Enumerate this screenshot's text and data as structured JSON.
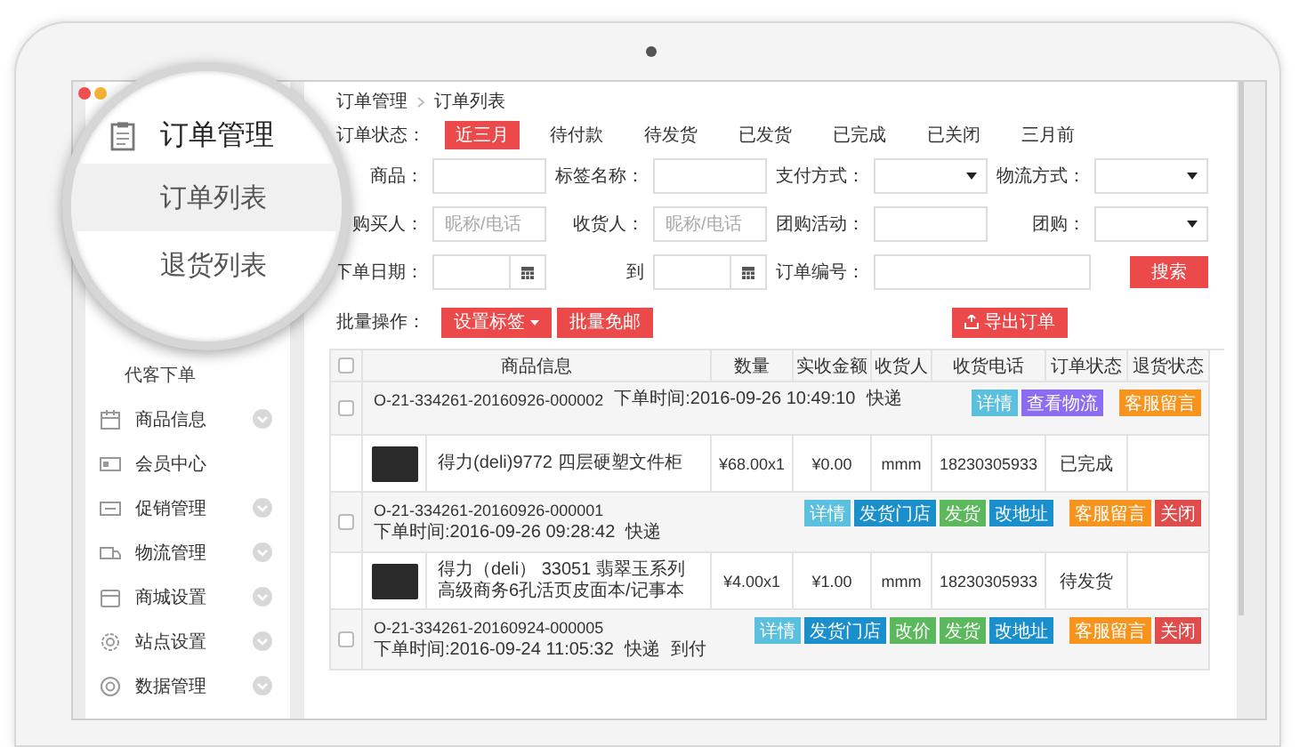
{
  "magnifier": {
    "title": "订单管理",
    "items": [
      {
        "label": "订单列表",
        "selected": true
      },
      {
        "label": "退货列表",
        "selected": false
      }
    ]
  },
  "sidebar": {
    "sub_items": [
      "代客下单"
    ],
    "sections": [
      {
        "label": "商品信息",
        "expandable": true
      },
      {
        "label": "会员中心",
        "expandable": false
      },
      {
        "label": "促销管理",
        "expandable": true
      },
      {
        "label": "物流管理",
        "expandable": true
      },
      {
        "label": "商城设置",
        "expandable": true
      },
      {
        "label": "站点设置",
        "expandable": true
      },
      {
        "label": "数据管理",
        "expandable": true
      }
    ]
  },
  "breadcrumb": [
    "订单管理",
    "订单列表"
  ],
  "status_filter": {
    "label": "订单状态：",
    "tabs": [
      {
        "label": "近三月",
        "selected": true
      },
      {
        "label": "待付款",
        "selected": false
      },
      {
        "label": "待发货",
        "selected": false
      },
      {
        "label": "已发货",
        "selected": false
      },
      {
        "label": "已完成",
        "selected": false
      },
      {
        "label": "已关闭",
        "selected": false
      },
      {
        "label": "三月前",
        "selected": false
      }
    ]
  },
  "filters": [
    [
      {
        "label": "商品：",
        "kind": "text"
      },
      {
        "label": "标签名称：",
        "kind": "text"
      },
      {
        "label": "支付方式：",
        "kind": "select"
      },
      {
        "label": "物流方式：",
        "kind": "select"
      }
    ],
    [
      {
        "label": "购买人：",
        "kind": "text",
        "placeholder": "昵称/电话"
      },
      {
        "label": "收货人：",
        "kind": "text",
        "placeholder": "昵称/电话"
      },
      {
        "label": "团购活动：",
        "kind": "text"
      },
      {
        "label": "团购：",
        "kind": "select"
      }
    ],
    [
      {
        "label": "下单日期：",
        "kind": "date"
      },
      {
        "label": "到",
        "kind": "date"
      },
      {
        "label": "订单编号：",
        "kind": "wide"
      }
    ]
  ],
  "search_button": "搜索",
  "batch": {
    "label": "批量操作：",
    "buttons": [
      {
        "label": "设置标签",
        "dropdown": true
      },
      {
        "label": "批量免邮",
        "dropdown": false
      }
    ],
    "export_button": "导出订单"
  },
  "table": {
    "columns": [
      "商品信息",
      "数量",
      "实收金额",
      "收货人",
      "收货电话",
      "订单状态",
      "退货状态"
    ],
    "header_checked": false,
    "orders": [
      {
        "checked": false,
        "order_no": "O-21-334261-20160926-000002",
        "time": "下单时间:2016-09-26 10:49:10",
        "tags": [
          "快递"
        ],
        "actions": [
          {
            "label": "详情",
            "kind": "info"
          },
          {
            "label": "查看物流",
            "kind": "purple"
          }
        ],
        "service_actions": [
          {
            "label": "客服留言",
            "kind": "warning"
          }
        ],
        "items": [
          {
            "name": "得力(deli)9772 四层硬塑文件柜",
            "quantity": "¥68.00x1",
            "paid": "¥0.00",
            "receiver": "mmm",
            "phone": "18230305933",
            "order_status": "已完成"
          }
        ]
      },
      {
        "checked": false,
        "order_no": "O-21-334261-20160926-000001",
        "time": "下单时间:2016-09-26 09:28:42",
        "tags": [
          "快递"
        ],
        "actions": [
          {
            "label": "详情",
            "kind": "info"
          },
          {
            "label": "发货门店",
            "kind": "primary"
          },
          {
            "label": "发货",
            "kind": "success"
          },
          {
            "label": "改地址",
            "kind": "primary"
          }
        ],
        "service_actions": [
          {
            "label": "客服留言",
            "kind": "warning"
          },
          {
            "label": "关闭",
            "kind": "danger"
          }
        ],
        "items": [
          {
            "name": "得力（deli） 33051 翡翠玉系列高级商务6孔活页皮面本/记事本",
            "quantity": "¥4.00x1",
            "paid": "¥1.00",
            "receiver": "mmm",
            "phone": "18230305933",
            "order_status": "待发货"
          }
        ]
      },
      {
        "checked": false,
        "order_no": "O-21-334261-20160924-000005",
        "time": "下单时间:2016-09-24 11:05:32",
        "tags": [
          "快递",
          "到付"
        ],
        "actions": [
          {
            "label": "详情",
            "kind": "info"
          },
          {
            "label": "发货门店",
            "kind": "primary"
          },
          {
            "label": "改价",
            "kind": "success"
          },
          {
            "label": "发货",
            "kind": "success"
          },
          {
            "label": "改地址",
            "kind": "primary"
          }
        ],
        "service_actions": [
          {
            "label": "客服留言",
            "kind": "warning"
          },
          {
            "label": "关闭",
            "kind": "danger"
          }
        ]
      }
    ]
  }
}
